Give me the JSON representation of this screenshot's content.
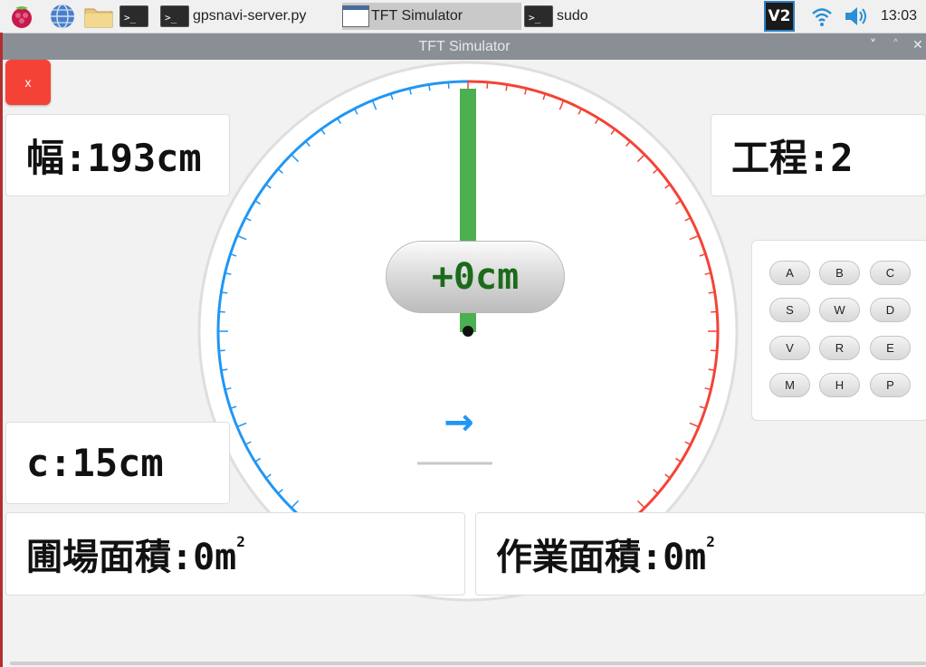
{
  "taskbar": {
    "tasks": [
      {
        "label": "gpsnavi-server.py"
      },
      {
        "label": "TFT Simulator"
      },
      {
        "label": "sudo"
      }
    ],
    "terminal_glyph": ">_",
    "vnc_label": "V2",
    "clock": "13:03"
  },
  "window": {
    "title": "TFT Simulator",
    "minimize_glyph": "˅",
    "maximize_glyph": "˄",
    "close_glyph": "✕"
  },
  "app": {
    "close_label": "x",
    "width_label": "幅:193cm",
    "process_label": "工程:2",
    "c_label": "c:15cm",
    "field_area_label": "圃場面積:0m",
    "work_area_label": "作業面積:0m",
    "area_unit_sup": "2",
    "offset_label": "+0cm",
    "direction_arrow": "→",
    "keys": [
      "A",
      "B",
      "C",
      "S",
      "W",
      "D",
      "V",
      "R",
      "E",
      "M",
      "H",
      "P"
    ],
    "gauge_offset_cm": 0,
    "colors": {
      "left_scale": "#2196f3",
      "right_scale": "#f44336",
      "needle": "#4caf50",
      "offset_text": "#1b6b1b",
      "close_button": "#f44336"
    }
  }
}
